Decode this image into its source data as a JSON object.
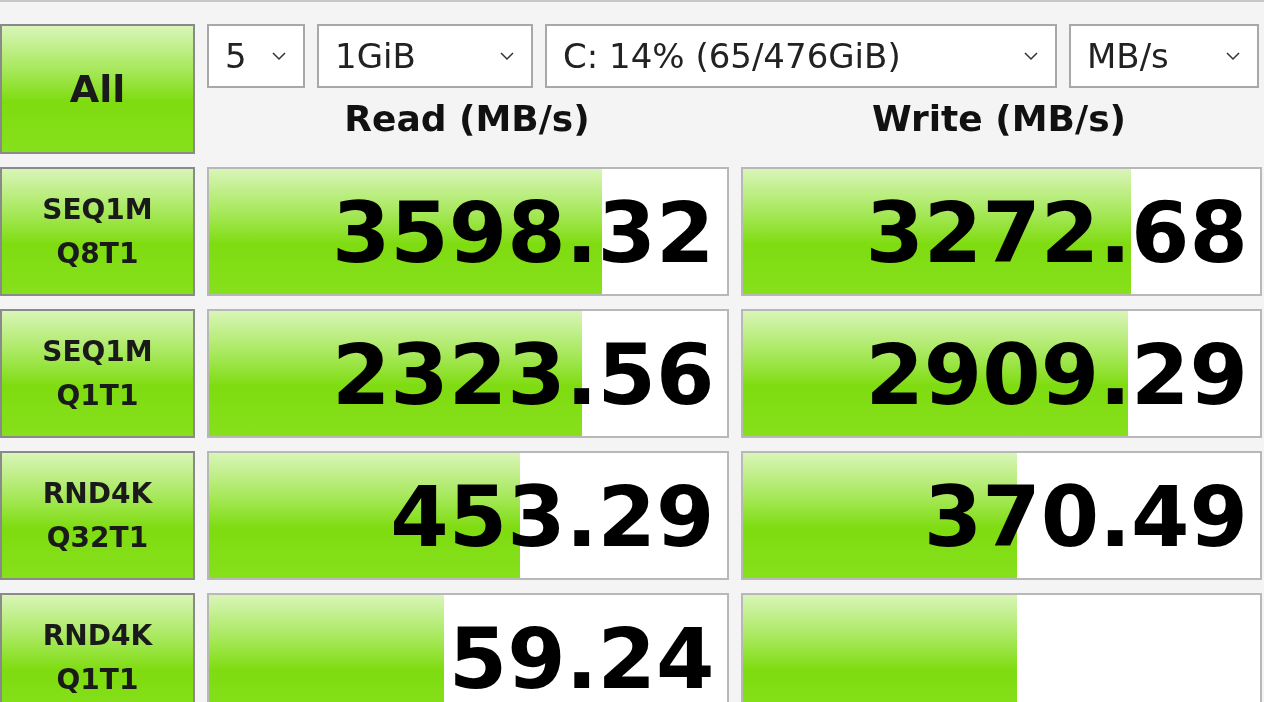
{
  "all_button": {
    "label": "All"
  },
  "selectors": [
    {
      "value": "5"
    },
    {
      "value": "1GiB"
    },
    {
      "value": "C: 14% (65/476GiB)"
    },
    {
      "value": "MB/s"
    }
  ],
  "columns": [
    {
      "label": "Read (MB/s)"
    },
    {
      "label": "Write (MB/s)"
    }
  ],
  "rows": [
    {
      "test": [
        "SEQ1M",
        "Q8T1"
      ],
      "read": {
        "value": "3598.32",
        "level": 0.76
      },
      "write": {
        "value": "3272.68",
        "level": 0.75
      }
    },
    {
      "test": [
        "SEQ1M",
        "Q1T1"
      ],
      "read": {
        "value": "2323.56",
        "level": 0.72
      },
      "write": {
        "value": "2909.29",
        "level": 0.745
      }
    },
    {
      "test": [
        "RND4K",
        "Q32T1"
      ],
      "read": {
        "value": "453.29",
        "level": 0.6
      },
      "write": {
        "value": "370.49",
        "level": 0.53
      }
    },
    {
      "test": [
        "RND4K",
        "Q1T1"
      ],
      "read": {
        "value": "59.24",
        "level": 0.455
      },
      "write": {
        "level": 0.53
      }
    }
  ]
}
